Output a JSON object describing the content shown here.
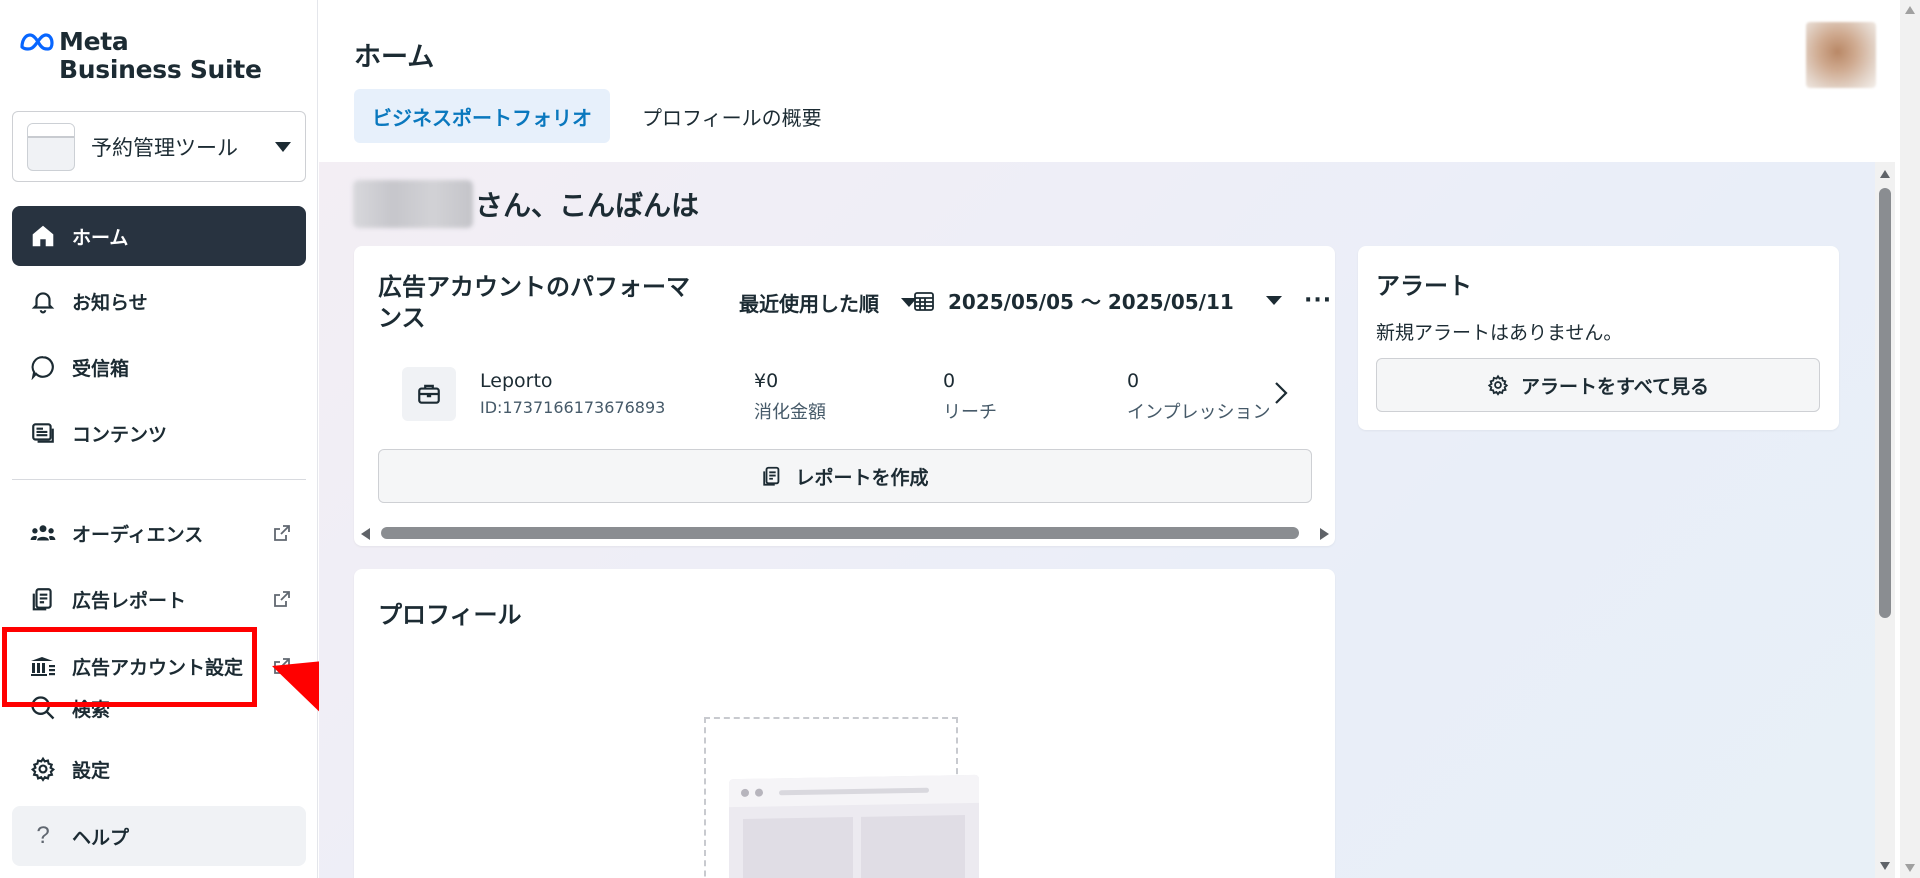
{
  "app": {
    "logo_line1": "Meta",
    "logo_line2": "Business Suite"
  },
  "selector": {
    "label": "予約管理ツール"
  },
  "sidebar": {
    "items": [
      {
        "label": "ホーム",
        "icon": "home-icon",
        "active": true
      },
      {
        "label": "お知らせ",
        "icon": "bell-icon"
      },
      {
        "label": "受信箱",
        "icon": "chat-bubble-icon"
      },
      {
        "label": "コンテンツ",
        "icon": "content-icon"
      },
      {
        "label": "オーディエンス",
        "icon": "people-icon",
        "external": true
      },
      {
        "label": "広告レポート",
        "icon": "report-icon",
        "external": true
      },
      {
        "label": "広告アカウント設定",
        "icon": "ad-account-icon",
        "external": true
      },
      {
        "label": "検索",
        "icon": "search-icon"
      },
      {
        "label": "設定",
        "icon": "gear-icon"
      },
      {
        "label": "ヘルプ",
        "icon": "help-icon"
      }
    ]
  },
  "header": {
    "title": "ホーム",
    "tabs": [
      {
        "label": "ビジネスポートフォリオ",
        "active": true
      },
      {
        "label": "プロフィールの概要",
        "active": false
      }
    ]
  },
  "greeting": {
    "suffix": "さん、こんばんは"
  },
  "performance": {
    "title": "広告アカウントのパフォーマンス",
    "sort_label": "最近使用した順",
    "date_range": "2025/05/05 ～ 2025/05/11",
    "more": "···",
    "account": {
      "name": "Leporto",
      "id": "ID:1737166173676893"
    },
    "metrics": [
      {
        "value": "¥0",
        "label": "消化金額"
      },
      {
        "value": "0",
        "label": "リーチ"
      },
      {
        "value": "0",
        "label": "インプレッション"
      }
    ],
    "report_button": "レポートを作成"
  },
  "profile": {
    "title": "プロフィール"
  },
  "alerts": {
    "title": "アラート",
    "message": "新規アラートはありません。",
    "button": "アラートをすべて見る"
  },
  "colors": {
    "active_nav_bg": "#283340",
    "accent_blue": "#0a78be",
    "annotation_red": "#ff0000",
    "logo_blue": "#0866ff"
  }
}
